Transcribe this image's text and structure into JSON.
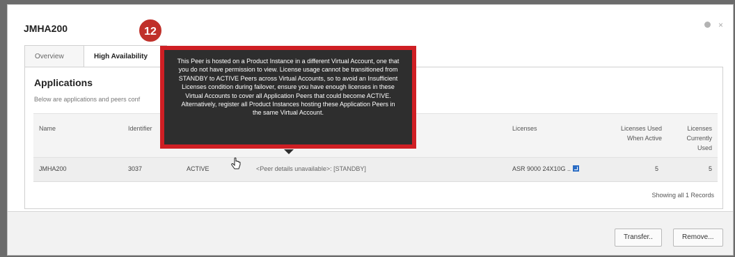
{
  "dialog": {
    "title": "JMHA200",
    "help_icon": "help-icon",
    "close_glyph": "×"
  },
  "step_badge": "12",
  "tabs": [
    {
      "label": "Overview",
      "active": false
    },
    {
      "label": "High Availability",
      "active": true
    }
  ],
  "applications": {
    "heading": "Applications",
    "subtitle": "Below are applications and peers conf",
    "columns": {
      "name": "Name",
      "identifier": "Identifier",
      "licenses": "Licenses",
      "used_when_active_1": "Licenses Used",
      "used_when_active_2": "When Active",
      "currently_used_1": "Licenses",
      "currently_used_2": "Currently",
      "currently_used_3": "Used"
    },
    "rows": [
      {
        "name": "JMHA200",
        "identifier": "3037",
        "status": "ACTIVE",
        "peer": "<Peer details unavailable>: [STANDBY]",
        "licenses": "ASR 9000 24X10G ..",
        "used_when_active": "5",
        "currently_used": "5"
      }
    ],
    "records": "Showing all 1 Records"
  },
  "tooltip": {
    "text": "This Peer is hosted on a Product Instance in a different Virtual Account, one that you do not have permission to view. License usage cannot be transitioned from STANDBY to ACTIVE Peers across Virtual Accounts, so to avoid an Insufficient Licenses condition during failover, ensure you have enough licenses in these Virtual Accounts to cover all Application Peers that could become ACTIVE. Alternatively, register all Product Instances hosting these Application Peers in the same Virtual Account."
  },
  "footer": {
    "transfer_label": "Transfer..",
    "remove_label": "Remove..."
  },
  "colors": {
    "badge": "#c0302a",
    "tooltip_border": "#cf1f24",
    "tooltip_bg": "#2e2e2e",
    "license_icon": "#2a6cc4"
  }
}
